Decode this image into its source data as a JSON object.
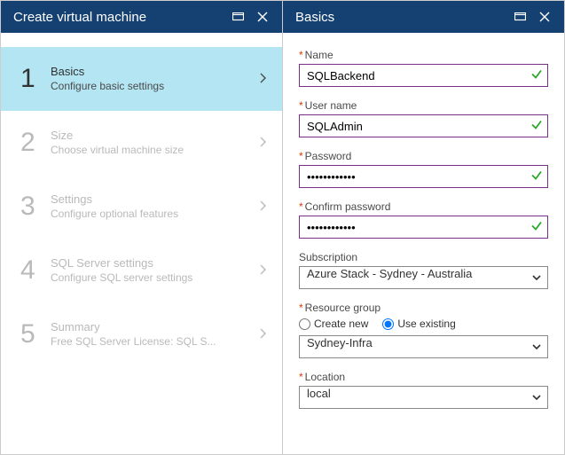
{
  "left": {
    "header_title": "Create virtual machine",
    "steps": [
      {
        "num": "1",
        "title": "Basics",
        "sub": "Configure basic settings"
      },
      {
        "num": "2",
        "title": "Size",
        "sub": "Choose virtual machine size"
      },
      {
        "num": "3",
        "title": "Settings",
        "sub": "Configure optional features"
      },
      {
        "num": "4",
        "title": "SQL Server settings",
        "sub": "Configure SQL server settings"
      },
      {
        "num": "5",
        "title": "Summary",
        "sub": "Free SQL Server License: SQL S..."
      }
    ]
  },
  "right": {
    "header_title": "Basics",
    "name_label": "Name",
    "name_value": "SQLBackend",
    "user_label": "User name",
    "user_value": "SQLAdmin",
    "password_label": "Password",
    "password_value": "••••••••••••",
    "confirm_label": "Confirm password",
    "confirm_value": "••••••••••••",
    "subscription_label": "Subscription",
    "subscription_value": "Azure Stack - Sydney - Australia",
    "rg_label": "Resource group",
    "rg_create_label": "Create new",
    "rg_existing_label": "Use existing",
    "rg_value": "Sydney-Infra",
    "location_label": "Location",
    "location_value": "local"
  },
  "glyphs": {
    "required": "*"
  }
}
